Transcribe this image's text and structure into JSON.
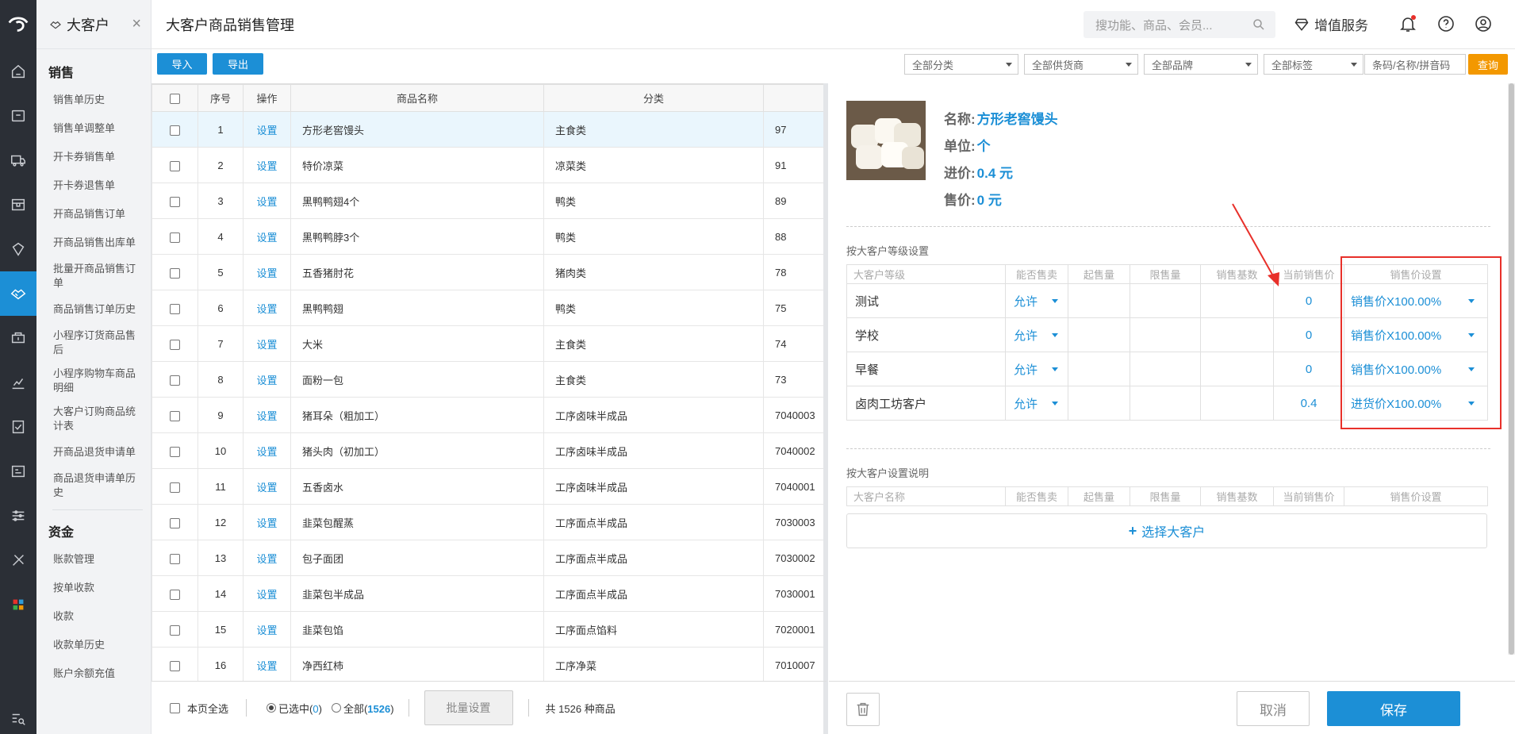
{
  "module": {
    "title": "大客户"
  },
  "page": {
    "title": "大客户商品销售管理"
  },
  "search": {
    "placeholder": "搜功能、商品、会员..."
  },
  "header": {
    "value_added_label": "增值服务"
  },
  "menu": {
    "sales_group": "销售",
    "sales_items": [
      "销售单历史",
      "销售单调整单",
      "开卡券销售单",
      "开卡券退售单",
      "开商品销售订单",
      "开商品销售出库单",
      "批量开商品销售订单",
      "商品销售订单历史",
      "小程序订货商品售后",
      "小程序购物车商品明细",
      "大客户订购商品统计表",
      "开商品退货申请单",
      "商品退货申请单历史"
    ],
    "funds_group": "资金",
    "funds_items": [
      "账款管理",
      "按单收款",
      "收款",
      "收款单历史",
      "账户余额充值"
    ]
  },
  "toolbar": {
    "import_label": "导入",
    "export_label": "导出",
    "filters": [
      "全部分类",
      "全部供货商",
      "全部品牌",
      "全部标签"
    ],
    "barcode_placeholder": "条码/名称/拼音码",
    "query_label": "查询"
  },
  "table": {
    "columns": {
      "seq": "序号",
      "op": "操作",
      "name": "商品名称",
      "category": "分类"
    },
    "op_label": "设置",
    "rows": [
      {
        "seq": "1",
        "name": "方形老窖馒头",
        "category": "主食类",
        "code": "97"
      },
      {
        "seq": "2",
        "name": "特价凉菜",
        "category": "凉菜类",
        "code": "91"
      },
      {
        "seq": "3",
        "name": "黑鸭鸭翅4个",
        "category": "鸭类",
        "code": "89"
      },
      {
        "seq": "4",
        "name": "黑鸭鸭脖3个",
        "category": "鸭类",
        "code": "88"
      },
      {
        "seq": "5",
        "name": "五香猪肘花",
        "category": "猪肉类",
        "code": "78"
      },
      {
        "seq": "6",
        "name": "黑鸭鸭翅",
        "category": "鸭类",
        "code": "75"
      },
      {
        "seq": "7",
        "name": "大米",
        "category": "主食类",
        "code": "74"
      },
      {
        "seq": "8",
        "name": "面粉一包",
        "category": "主食类",
        "code": "73"
      },
      {
        "seq": "9",
        "name": "猪耳朵（粗加工）",
        "category": "工序卤味半成品",
        "code": "7040003"
      },
      {
        "seq": "10",
        "name": "猪头肉（初加工）",
        "category": "工序卤味半成品",
        "code": "7040002"
      },
      {
        "seq": "11",
        "name": "五香卤水",
        "category": "工序卤味半成品",
        "code": "7040001"
      },
      {
        "seq": "12",
        "name": "韭菜包醒蒸",
        "category": "工序面点半成品",
        "code": "7030003"
      },
      {
        "seq": "13",
        "name": "包子面团",
        "category": "工序面点半成品",
        "code": "7030002"
      },
      {
        "seq": "14",
        "name": "韭菜包半成品",
        "category": "工序面点半成品",
        "code": "7030001"
      },
      {
        "seq": "15",
        "name": "韭菜包馅",
        "category": "工序面点馅料",
        "code": "7020001"
      },
      {
        "seq": "16",
        "name": "净西红柿",
        "category": "工序净菜",
        "code": "7010007"
      }
    ]
  },
  "footer": {
    "page_select_all": "本页全选",
    "selected_label": "已选中(",
    "selected_count": "0",
    "all_label": "全部(",
    "all_count": "1526",
    "close_paren": ")",
    "batch_label": "批量设置",
    "total_text": "共 1526 种商品"
  },
  "detail": {
    "name_key": "名称:",
    "name_value": "方形老窖馒头",
    "unit_key": "单位:",
    "unit_value": "个",
    "purchase_key": "进价:",
    "purchase_value": "0.4 元",
    "sale_key": "售价:",
    "sale_value": "0 元",
    "level_section": "按大客户等级设置",
    "level_columns": [
      "大客户等级",
      "能否售卖",
      "起售量",
      "限售量",
      "销售基数",
      "当前销售价",
      "销售价设置"
    ],
    "levels": [
      {
        "name": "测试",
        "allow": "允许",
        "price": "0",
        "setting": "销售价X100.00%"
      },
      {
        "name": "学校",
        "allow": "允许",
        "price": "0",
        "setting": "销售价X100.00%"
      },
      {
        "name": "早餐",
        "allow": "允许",
        "price": "0",
        "setting": "销售价X100.00%"
      },
      {
        "name": "卤肉工坊客户",
        "allow": "允许",
        "price": "0.4",
        "setting": "进货价X100.00%"
      }
    ],
    "customer_section": "按大客户设置说明",
    "customer_columns": [
      "大客户名称",
      "能否售卖",
      "起售量",
      "限售量",
      "销售基数",
      "当前销售价",
      "销售价设置"
    ],
    "add_customer_label": "选择大客户",
    "cancel_label": "取消",
    "save_label": "保存"
  },
  "colors": {
    "accent": "#1c8fd6",
    "query": "#f39800",
    "highlight": "#e8302a"
  }
}
